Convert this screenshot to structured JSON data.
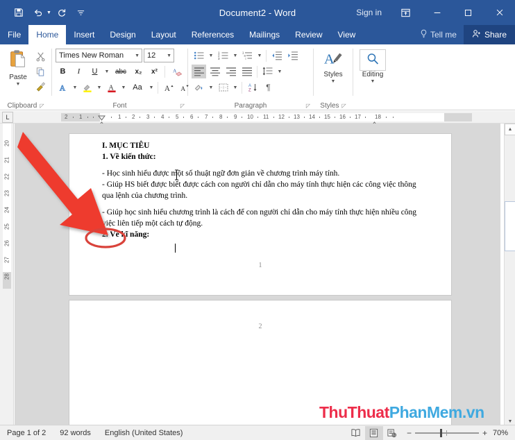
{
  "titlebar": {
    "document_title": "Document2  -  Word",
    "signin_label": "Sign in",
    "quick_access": [
      {
        "name": "save-icon",
        "label": "Save"
      },
      {
        "name": "undo-icon",
        "label": "Undo"
      },
      {
        "name": "redo-icon",
        "label": "Redo"
      },
      {
        "name": "customize-qat-icon",
        "label": "Customize Quick Access Toolbar"
      }
    ],
    "window_controls": [
      {
        "name": "ribbon-display-options-icon",
        "label": "Ribbon Display Options"
      },
      {
        "name": "minimize-icon",
        "label": "Minimize"
      },
      {
        "name": "maximize-icon",
        "label": "Maximize"
      },
      {
        "name": "close-icon",
        "label": "Close"
      }
    ]
  },
  "ribbon_tabs": {
    "items": [
      {
        "label": "File",
        "active": false
      },
      {
        "label": "Home",
        "active": true
      },
      {
        "label": "Insert",
        "active": false
      },
      {
        "label": "Design",
        "active": false
      },
      {
        "label": "Layout",
        "active": false
      },
      {
        "label": "References",
        "active": false
      },
      {
        "label": "Mailings",
        "active": false
      },
      {
        "label": "Review",
        "active": false
      },
      {
        "label": "View",
        "active": false
      }
    ],
    "tell_me": "Tell me",
    "share": "Share"
  },
  "ribbon": {
    "groups": [
      {
        "label": "Clipboard"
      },
      {
        "label": "Font"
      },
      {
        "label": "Paragraph"
      },
      {
        "label": "Styles"
      }
    ],
    "clipboard": {
      "paste_label": "Paste",
      "cut_label": "Cut",
      "copy_label": "Copy",
      "format_painter_label": "Format Painter"
    },
    "font": {
      "font_name": "Times New Roman",
      "font_size": "12",
      "bold": "B",
      "italic": "I",
      "underline": "U",
      "strikethrough": "abc",
      "subscript": "x₂",
      "superscript": "x²",
      "clear_formatting": "Clear All Formatting",
      "text_effects": "A",
      "highlight": "Text Highlight Color",
      "font_color": "Font Color",
      "change_case": "Aa",
      "grow_font": "A",
      "shrink_font": "A"
    },
    "paragraph": {
      "bullets": "Bullets",
      "numbering": "Numbering",
      "multilevel": "Multilevel List",
      "decrease_indent": "Decrease Indent",
      "increase_indent": "Increase Indent",
      "align_left": "Align Left",
      "align_center": "Center",
      "align_right": "Align Right",
      "justify": "Justify",
      "line_spacing": "Line and Paragraph Spacing",
      "shading": "Shading",
      "borders": "Borders",
      "sort": "Sort",
      "show_marks": "¶"
    },
    "styles": {
      "label": "Styles"
    },
    "editing": {
      "label": "Editing"
    }
  },
  "rulers": {
    "horizontal_numbers": [
      "2",
      "1",
      "1",
      "2",
      "3",
      "4",
      "5",
      "6",
      "7",
      "8",
      "9",
      "10",
      "11",
      "12",
      "13",
      "14",
      "15",
      "16",
      "17",
      "18"
    ],
    "vertical_numbers": [
      "20",
      "21",
      "22",
      "23",
      "24",
      "25",
      "26",
      "27",
      "28"
    ],
    "tab_selector": "L"
  },
  "document": {
    "page1": {
      "paragraphs": [
        {
          "text": "I. MỤC TIÊU",
          "bold": true,
          "spaced": false
        },
        {
          "text": "1. Về kiến thức:",
          "bold": true,
          "spaced": false
        },
        {
          "text": "- Học sinh hiểu được một số thuật ngữ đơn giản về chương trình máy tính.",
          "bold": false,
          "spaced": true
        },
        {
          "text": "- Giúp HS biết được biết được cách con người chỉ dẫn cho máy tính thực hiện các công việc thông qua lệnh của chương trình.",
          "bold": false,
          "spaced": false
        },
        {
          "text": "- Giúp học sinh hiểu chương trình là cách để con người chỉ dẫn cho máy tính thực hiện nhiều công việc liên tiếp một cách tự động.",
          "bold": false,
          "spaced": true
        },
        {
          "text": "2. Về kĩ năng:",
          "bold": true,
          "spaced": false
        }
      ],
      "footer_number": "1"
    },
    "page2": {
      "footer_number": "2"
    }
  },
  "annotations": {
    "arrow": {
      "name": "red-arrow-annotation",
      "color": "#EE3B2F"
    },
    "ellipse": {
      "name": "red-ellipse-annotation",
      "color": "#D9433B"
    }
  },
  "scrollbar": {
    "up_label": "Scroll Up",
    "down_label": "Scroll Down",
    "thumb_label": "Vertical Scroll Thumb"
  },
  "statusbar": {
    "page_info": "Page 1 of 2",
    "word_count": "92 words",
    "language": "English (United States)",
    "views": [
      {
        "name": "read-mode-icon",
        "label": "Read Mode",
        "active": false
      },
      {
        "name": "print-layout-icon",
        "label": "Print Layout",
        "active": true
      },
      {
        "name": "web-layout-icon",
        "label": "Web Layout",
        "active": false
      }
    ],
    "zoom_out": "−",
    "zoom_in": "+",
    "zoom_level": "70%"
  },
  "watermark": {
    "part1": "ThuThuat",
    "part2": "PhanMem.vn",
    "color1": "#ED2D4A",
    "color2": "#3FA9E0"
  }
}
